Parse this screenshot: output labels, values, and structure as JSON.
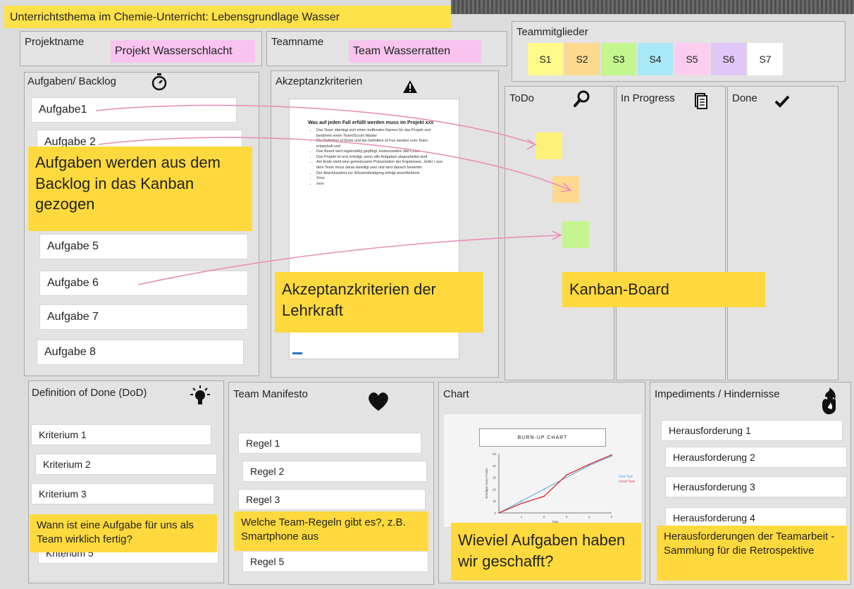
{
  "header": {
    "title": "Unterrichtsthema im Chemie-Unterricht: Lebensgrundlage Wasser"
  },
  "project": {
    "label": "Projektname",
    "value": "Projekt Wasserschlacht"
  },
  "team": {
    "label": "Teamname",
    "value": "Team Wasserratten"
  },
  "members": {
    "label": "Teammitglieder",
    "items": [
      {
        "name": "S1",
        "color": "#fffa8a"
      },
      {
        "name": "S2",
        "color": "#fcd98e"
      },
      {
        "name": "S3",
        "color": "#c4f58e"
      },
      {
        "name": "S4",
        "color": "#a8e8f7"
      },
      {
        "name": "S5",
        "color": "#fccdf0"
      },
      {
        "name": "S6",
        "color": "#e1c6f7"
      },
      {
        "name": "S7",
        "color": "#ffffff"
      }
    ]
  },
  "backlog": {
    "label": "Aufgaben/ Backlog",
    "icon": "stopwatch-icon",
    "items": [
      "Aufgabe1",
      "Aufgabe 2",
      "Aufgabe 5",
      "Aufgabe 6",
      "Aufgabe 7",
      "Aufgabe 8"
    ],
    "note": "Aufgaben werden aus dem Backlog in das Kanban gezogen"
  },
  "acceptance": {
    "label": "Akzeptanzkriterien",
    "icon": "warning-icon",
    "doc_title": "Was auf jeden Fall erfüllt werden muss im Projekt xxx",
    "doc_items": [
      "Das Team überlegt sich einen treffenden Namen für das Projekt und bestimmt einen Team/Scrum Master",
      "Die Definition of Done und die Definition of Fun werden vom Team entwickelt und",
      "Das Board wird regelmäßig gepflegt, insbesondere das Chart",
      "Das Projekt ist erst erledigt, wenn alle Aufgaben abgearbeitet sind",
      "Am Ende steht eine gemeinsame Präsentation der Ergebnisse. Jeder r aus dem Team muss daran beteiligt sein und wird danach bewertet",
      "Der Abschlusstest zur Wissensfestigung erfolgt anschließend",
      "Xxxx",
      "xxxx"
    ],
    "note": "Akzeptanzkriterien der Lehrkraft"
  },
  "kanban": {
    "columns": [
      {
        "label": "ToDo",
        "icon": "magnifier-icon"
      },
      {
        "label": "In Progress",
        "icon": "document-icon"
      },
      {
        "label": "Done",
        "icon": "checkmark-icon"
      }
    ],
    "stickies": [
      {
        "color": "#fff27a"
      },
      {
        "color": "#fcd98e"
      },
      {
        "color": "#c4f58e"
      }
    ],
    "note": "Kanban-Board"
  },
  "dod": {
    "label": "Definition of Done (DoD)",
    "icon": "lightbulb-icon",
    "items": [
      "Kriterium 1",
      "Kriterium 2",
      "Kriterium 3",
      "Kriterium 5"
    ],
    "note": "Wann ist eine Aufgabe für uns als Team wirklich fertig?"
  },
  "manifesto": {
    "label": "Team Manifesto",
    "icon": "heart-icon",
    "items": [
      "Regel 1",
      "Regel 2",
      "Regel 3",
      "Regel 5"
    ],
    "note": "Welche Team-Regeln gibt es?, z.B. Smartphone aus"
  },
  "chart_panel": {
    "label": "Chart",
    "note": "Wieviel Aufgaben haben wir geschafft?"
  },
  "chart_data": {
    "type": "line",
    "title": "BURN-UP CHART",
    "xlabel": "Tage",
    "ylabel": "Erledigte Story Points",
    "x": [
      0,
      1,
      2,
      3,
      4,
      5
    ],
    "xlim": [
      0,
      5
    ],
    "ylim": [
      0,
      50
    ],
    "yticks": [
      0,
      10,
      20,
      30,
      40,
      50
    ],
    "series": [
      {
        "name": "Ideal Task",
        "color": "#3aa7d8",
        "values": [
          0,
          10,
          20,
          30,
          40,
          48
        ]
      },
      {
        "name": "Actual Task",
        "color": "#d9343a",
        "values": [
          0,
          8,
          14,
          32,
          41,
          49
        ]
      }
    ],
    "grid": false,
    "legend": "right"
  },
  "impediments": {
    "label": "Impediments / Hindernisse",
    "icon": "fire-hand-icon",
    "items": [
      "Herausforderung 1",
      "Herausforderung 2",
      "Herausforderung 3",
      "Herausforderung 4"
    ],
    "note": "Herausforderungen der Teamarbeit - Sammlung für die Retrospektive"
  }
}
